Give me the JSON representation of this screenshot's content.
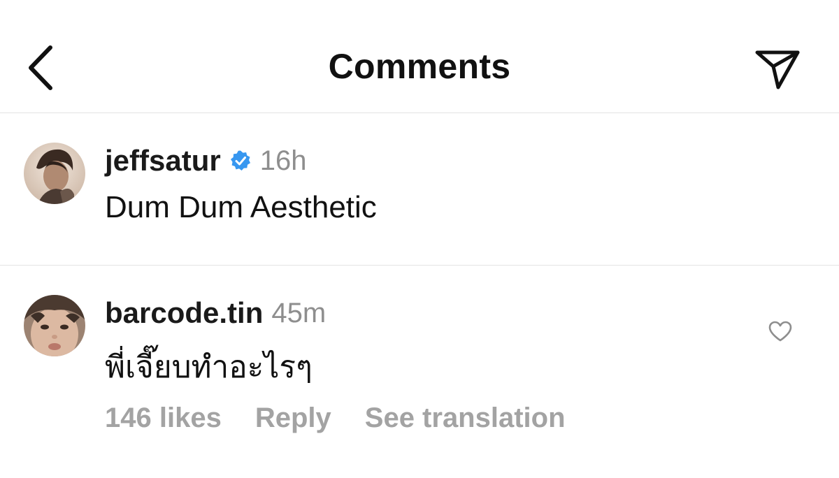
{
  "header": {
    "title": "Comments",
    "back_icon": "chevron-left-icon",
    "share_icon": "paper-plane-icon"
  },
  "comments": [
    {
      "username": "jeffsatur",
      "verified": true,
      "time": "16h",
      "text": "Dum Dum Aesthetic",
      "verified_color": "#3797f0"
    },
    {
      "username": "barcode.tin",
      "verified": false,
      "time": "45m",
      "text": "พี่เจี๊ยบทำอะไรๆ",
      "likes": "146 likes",
      "reply_label": "Reply",
      "translate_label": "See translation",
      "like_icon": "heart-outline-icon"
    }
  ],
  "colors": {
    "text": "#111111",
    "secondary": "#8e8e8e",
    "action": "#a3a3a3",
    "divider": "#e3e3e3",
    "verified": "#3797f0"
  }
}
